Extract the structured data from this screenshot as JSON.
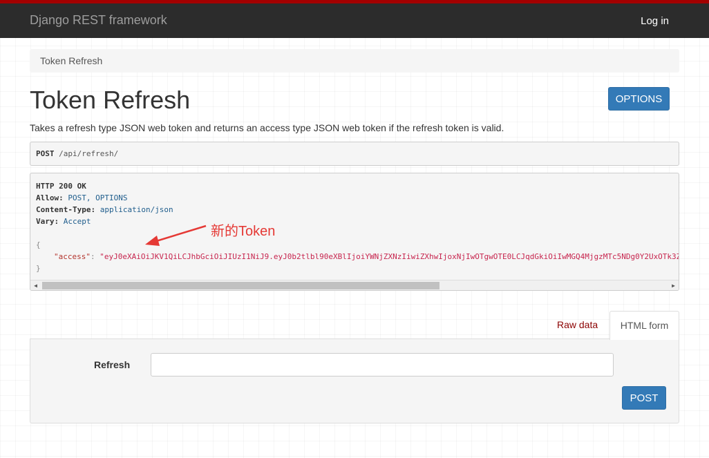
{
  "navbar": {
    "brand": "Django REST framework",
    "login_label": "Log in"
  },
  "breadcrumb": {
    "current": "Token Refresh"
  },
  "page": {
    "title": "Token Refresh",
    "options_label": "OPTIONS",
    "description": "Takes a refresh type JSON web token and returns an access type JSON web token if the refresh token is valid."
  },
  "request": {
    "method": "POST",
    "url": "/api/refresh/"
  },
  "response": {
    "status": "HTTP 200 OK",
    "headers": [
      {
        "key": "Allow:",
        "value": "POST, OPTIONS"
      },
      {
        "key": "Content-Type:",
        "value": "application/json"
      },
      {
        "key": "Vary:",
        "value": "Accept"
      }
    ],
    "open_brace": "{",
    "close_brace": "}",
    "body_key": "\"access\"",
    "body_sep": ": ",
    "body_value": "\"eyJ0eXAiOiJKV1QiLCJhbGciOiJIUzI1NiJ9.eyJ0b2tlbl90eXBlIjoiYWNjZXNzIiwiZXhwIjoxNjIwOTgwOTE0LCJqdGkiOiIwMGQ4MjgzMTc5NDg0Y2UxOTk3Z"
  },
  "annotation": {
    "text": "新的Token",
    "color": "#e53935"
  },
  "tabs": {
    "raw_label": "Raw data",
    "html_label": "HTML form"
  },
  "form": {
    "field_label": "Refresh",
    "field_value": "",
    "submit_label": "POST"
  },
  "colors": {
    "accent": "#a30000",
    "navbar": "#2c2c2c",
    "primary": "#337ab7"
  }
}
